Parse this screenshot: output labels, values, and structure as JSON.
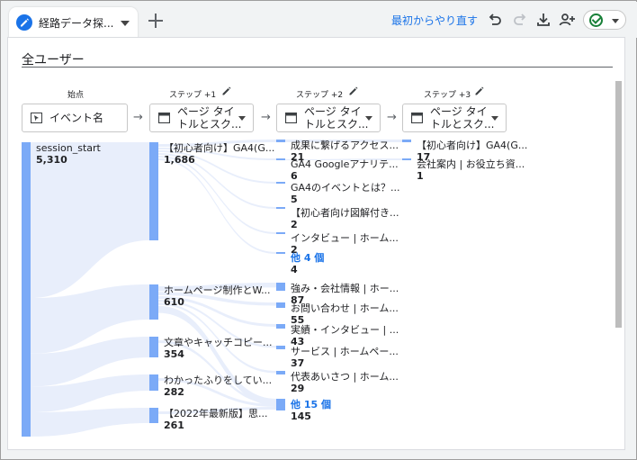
{
  "app": {
    "tab_title": "経路データ探...",
    "restart_label": "最初からやり直す",
    "icons": {
      "tab": "pencil-icon",
      "add_tab": "plus-icon",
      "undo": "undo-icon",
      "redo": "redo-icon",
      "download": "download-icon",
      "share": "person-add-icon",
      "status": "check-circle-icon"
    }
  },
  "segment": {
    "title": "全ユーザー"
  },
  "steps": {
    "start_label": "始点",
    "step1_label": "ステップ +1",
    "step2_label": "ステップ +2",
    "step3_label": "ステップ +3",
    "start_dimension": "イベント名",
    "page_dimension_line1": "ページ タイ",
    "page_dimension_line2": "トルとスク..."
  },
  "colors": {
    "node": "#7baaf7",
    "link": "#e8eefb",
    "accent": "#1a73e8"
  },
  "chart_data": {
    "type": "sankey",
    "columns": [
      {
        "step": "始点",
        "nodes": [
          {
            "label": "session_start",
            "value": "5,310"
          }
        ]
      },
      {
        "step": "ステップ +1",
        "nodes": [
          {
            "label": "【初心者向け】GA4(G...",
            "value": "1,686"
          },
          {
            "label": "ホームページ制作とW...",
            "value": "610"
          },
          {
            "label": "文章やキャッチコピー...",
            "value": "354"
          },
          {
            "label": "わかったふりをしてい...",
            "value": "282"
          },
          {
            "label": "【2022年最新版】思...",
            "value": "261"
          }
        ]
      },
      {
        "step": "ステップ +2",
        "nodes": [
          {
            "label": "成果に繋げるアクセス...",
            "value": "21"
          },
          {
            "label": "GA4 Googleアナリテ...",
            "value": "6"
          },
          {
            "label": "GA4のイベントとは？...",
            "value": "5"
          },
          {
            "label": "【初心者向け図解付き...",
            "value": "2"
          },
          {
            "label": "インタビュー | ホーム...",
            "value": "2"
          },
          {
            "label": "他 4 個",
            "value": "4",
            "more": true
          },
          {
            "label": "強み・会社情報 | ホー...",
            "value": "87"
          },
          {
            "label": "お問い合わせ | ホーム...",
            "value": "55"
          },
          {
            "label": "実績・インタビュー | ...",
            "value": "43"
          },
          {
            "label": "サービス | ホームペー...",
            "value": "37"
          },
          {
            "label": "代表あいさつ | ホーム...",
            "value": "29"
          },
          {
            "label": "他 15 個",
            "value": "145",
            "more": true
          }
        ]
      },
      {
        "step": "ステップ +3",
        "nodes": [
          {
            "label": "【初心者向け】GA4(G...",
            "value": "17"
          },
          {
            "label": "会社案内 | お役立ち資...",
            "value": "1"
          }
        ]
      }
    ]
  }
}
